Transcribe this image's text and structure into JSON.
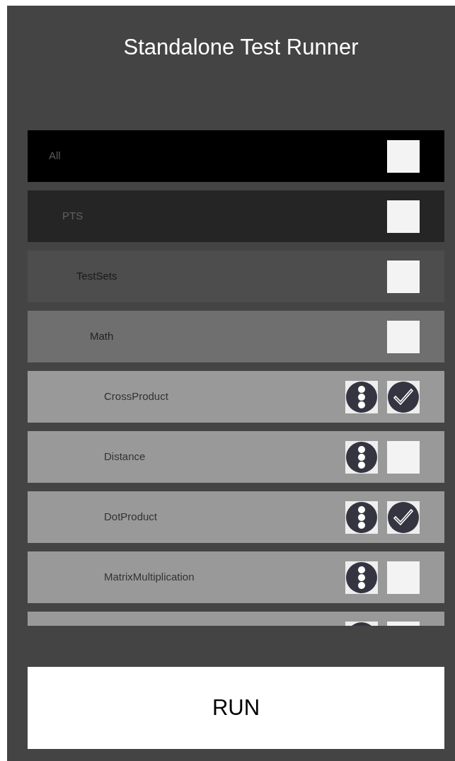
{
  "title": "Standalone Test Runner",
  "tree": [
    {
      "name": "All",
      "checked": false,
      "children": [
        {
          "name": "PTS",
          "checked": false,
          "children": [
            {
              "name": "TestSets",
              "checked": false,
              "children": [
                {
                  "name": "Math",
                  "checked": false,
                  "children": [
                    {
                      "name": "CrossProduct",
                      "checked": true
                    },
                    {
                      "name": "Distance",
                      "checked": false
                    },
                    {
                      "name": "DotProduct",
                      "checked": true
                    },
                    {
                      "name": "MatrixMultiplication",
                      "checked": false
                    },
                    {
                      "checked": false
                    }
                  ]
                }
              ]
            }
          ]
        }
      ]
    }
  ],
  "run_button": "RUN"
}
